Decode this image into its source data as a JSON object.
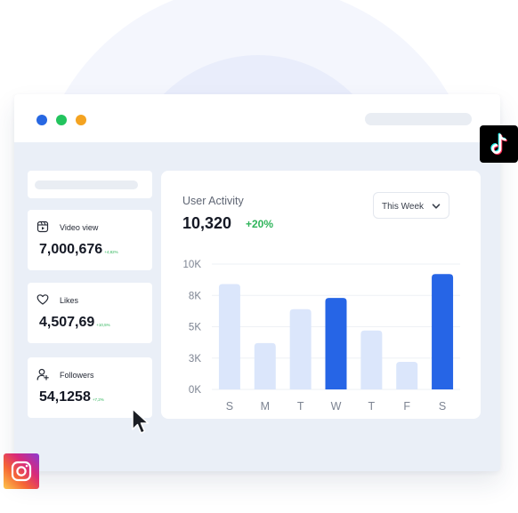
{
  "window": {
    "controls": [
      "close",
      "minimize",
      "maximize"
    ]
  },
  "sidebar": {
    "stats": [
      {
        "icon": "video-icon",
        "label": "Video view",
        "value": "7,000,676",
        "change": "+4,82%"
      },
      {
        "icon": "heart-icon",
        "label": "Likes",
        "value": "4,507,69",
        "change": "+10,5%"
      },
      {
        "icon": "add-user-icon",
        "label": "Followers",
        "value": "54,1258",
        "change": "+7,2%"
      }
    ]
  },
  "activity": {
    "title": "User Activity",
    "total": "10,320",
    "change": "+20%",
    "period": "This Week"
  },
  "chart_data": {
    "type": "bar",
    "categories": [
      "S",
      "M",
      "T",
      "W",
      "T",
      "F",
      "S"
    ],
    "values": [
      8.4,
      3.7,
      6.4,
      7.3,
      4.7,
      2.2,
      9.2
    ],
    "highlighted": [
      false,
      false,
      false,
      true,
      false,
      false,
      true
    ],
    "ytick_labels": [
      "0K",
      "3K",
      "5K",
      "8K",
      "10K"
    ],
    "ylim": [
      0,
      10
    ],
    "grid": true,
    "colors": {
      "highlight": "#2665e6",
      "normal": "#dbe6fb"
    }
  },
  "badges": {
    "top_right": "tiktok-icon",
    "bottom_left": "instagram-icon"
  },
  "colors": {
    "accent": "#2665e6",
    "positive": "#2fb45a",
    "window_bg": "#eaeff7"
  }
}
